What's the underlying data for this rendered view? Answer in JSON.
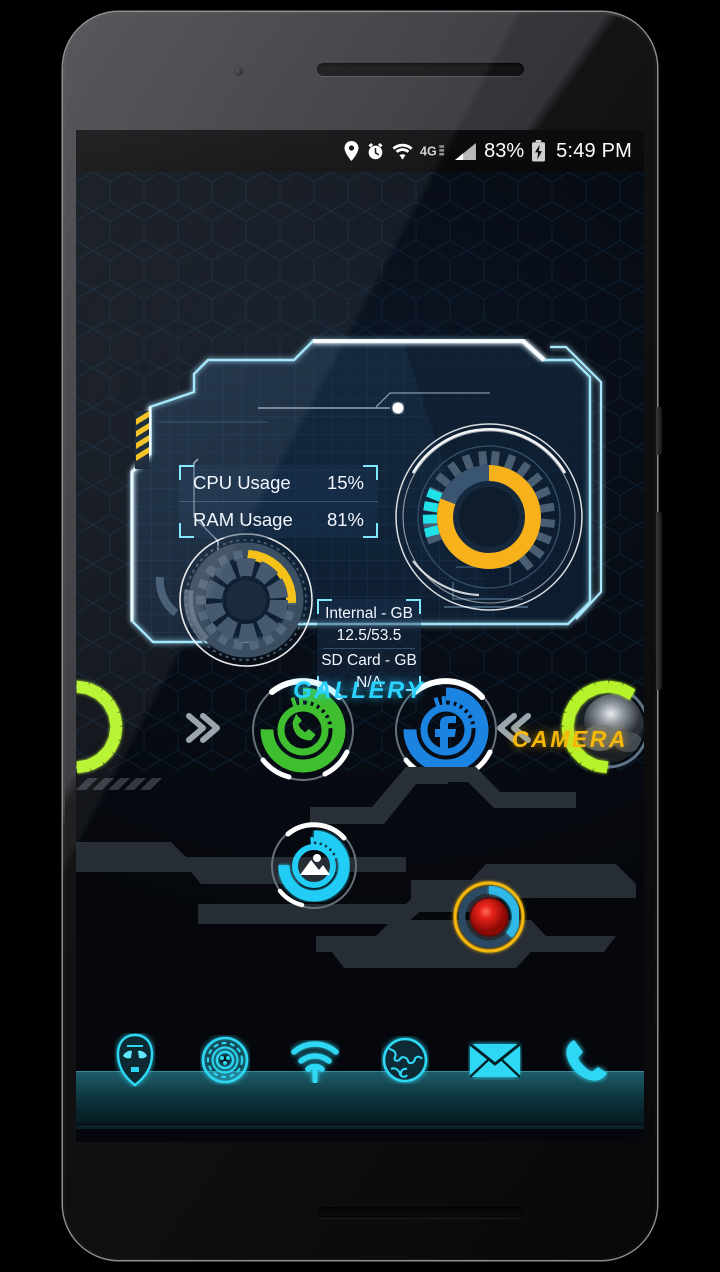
{
  "status_bar": {
    "icons": [
      "location-icon",
      "alarm-icon",
      "wifi-icon",
      "network-4g-icon",
      "signal-bars-icon"
    ],
    "network_label": "4G",
    "battery_percent": "83%",
    "battery_state": "charging",
    "time": "5:49 PM"
  },
  "hud_widget": {
    "cpu": {
      "label": "CPU Usage",
      "value": "15%"
    },
    "ram": {
      "label": "RAM Usage",
      "value": "81%"
    },
    "storage": {
      "internal_label": "Internal - GB",
      "internal_value": "12.5/53.5",
      "sdcard_label": "SD Card - GB",
      "sdcard_value": "N/A"
    },
    "gauges": {
      "ram_gauge_percent": 81,
      "ram_gauge_color": "#f7b11a",
      "cpu_gauge_percent": 15,
      "cpu_gauge_color": "#20e0e8",
      "storage_gauge_percent": 23,
      "storage_gauge_color": "#f5c21a"
    },
    "frame_color": "#bfefff",
    "panel_fill": "#122031",
    "hazard_color": "#f3c018"
  },
  "app_shortcuts": [
    {
      "name": "whatsapp",
      "label": "",
      "accent": "#3fbf2f",
      "glyph": "phone-handset-icon"
    },
    {
      "name": "facebook",
      "label": "",
      "accent": "#1b84e0",
      "glyph": "facebook-f-icon"
    },
    {
      "name": "gallery",
      "label": "GALLERY",
      "accent": "#22cdf5",
      "glyph": "photo-mountain-icon"
    },
    {
      "name": "camera",
      "label": "CAMERA",
      "accent": "#f5b709",
      "glyph": "camera-lens-icon"
    }
  ],
  "page_nav": {
    "next_icon": "chevron-double-right-icon",
    "prev_icon": "chevron-double-left-icon",
    "ring_accent": "#b6f32b"
  },
  "dock": {
    "items": [
      {
        "name": "ironman-helmet",
        "icon": "ironman-helmet-icon"
      },
      {
        "name": "settings-arc",
        "icon": "arc-reactor-icon"
      },
      {
        "name": "wifi",
        "icon": "wifi-icon"
      },
      {
        "name": "browser",
        "icon": "globe-icon"
      },
      {
        "name": "email",
        "icon": "envelope-icon"
      },
      {
        "name": "phone",
        "icon": "phone-handset-icon"
      }
    ],
    "accent": "#2fd8f5"
  },
  "theme": {
    "accent_cyan": "#2fd8f5",
    "accent_amber": "#f5b709",
    "accent_green": "#b6f32b"
  }
}
